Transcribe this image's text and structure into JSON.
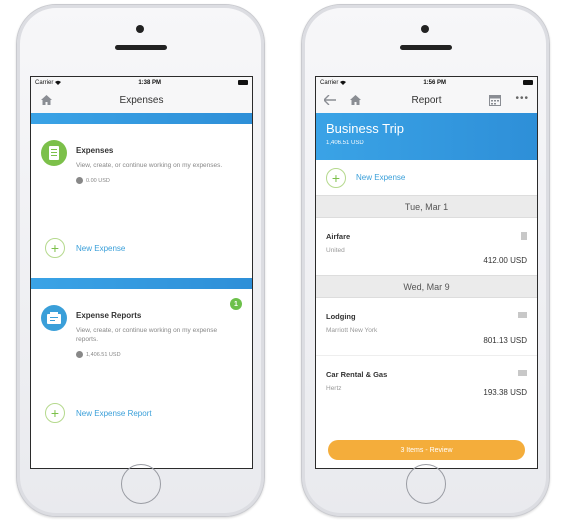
{
  "left_phone": {
    "status": {
      "carrier": "Carrier",
      "time": "1:38 PM"
    },
    "nav": {
      "title": "Expenses"
    },
    "expenses_section": {
      "title": "Expenses",
      "description": "View, create, or continue working on my expenses.",
      "amount": "0.00 USD",
      "icon": "receipt-icon"
    },
    "new_expense": {
      "label": "New Expense"
    },
    "reports_section": {
      "title": "Expense Reports",
      "description": "View, create, or continue working on my expense reports.",
      "amount": "1,406.51 USD",
      "badge": "1",
      "icon": "reports-icon"
    },
    "new_report": {
      "label": "New Expense Report"
    }
  },
  "right_phone": {
    "status": {
      "carrier": "Carrier",
      "time": "1:56 PM"
    },
    "nav": {
      "title": "Report"
    },
    "header": {
      "title": "Business Trip",
      "amount": "1,406.51 USD"
    },
    "new_expense": {
      "label": "New Expense"
    },
    "groups": [
      {
        "date": "Tue, Mar 1",
        "items": [
          {
            "title": "Airfare",
            "vendor": "United",
            "amount": "412.00 USD"
          }
        ]
      },
      {
        "date": "Wed, Mar 9",
        "items": [
          {
            "title": "Lodging",
            "vendor": "Marriott New York",
            "amount": "801.13 USD"
          },
          {
            "title": "Car Rental & Gas",
            "vendor": "Hertz",
            "amount": "193.38 USD"
          }
        ]
      }
    ],
    "review_button": {
      "label": "3 Items - Review"
    }
  },
  "colors": {
    "accent_blue": "#2e8fd8",
    "link_blue": "#3a9fd9",
    "green": "#6cc04a",
    "orange": "#f4ad3b"
  }
}
